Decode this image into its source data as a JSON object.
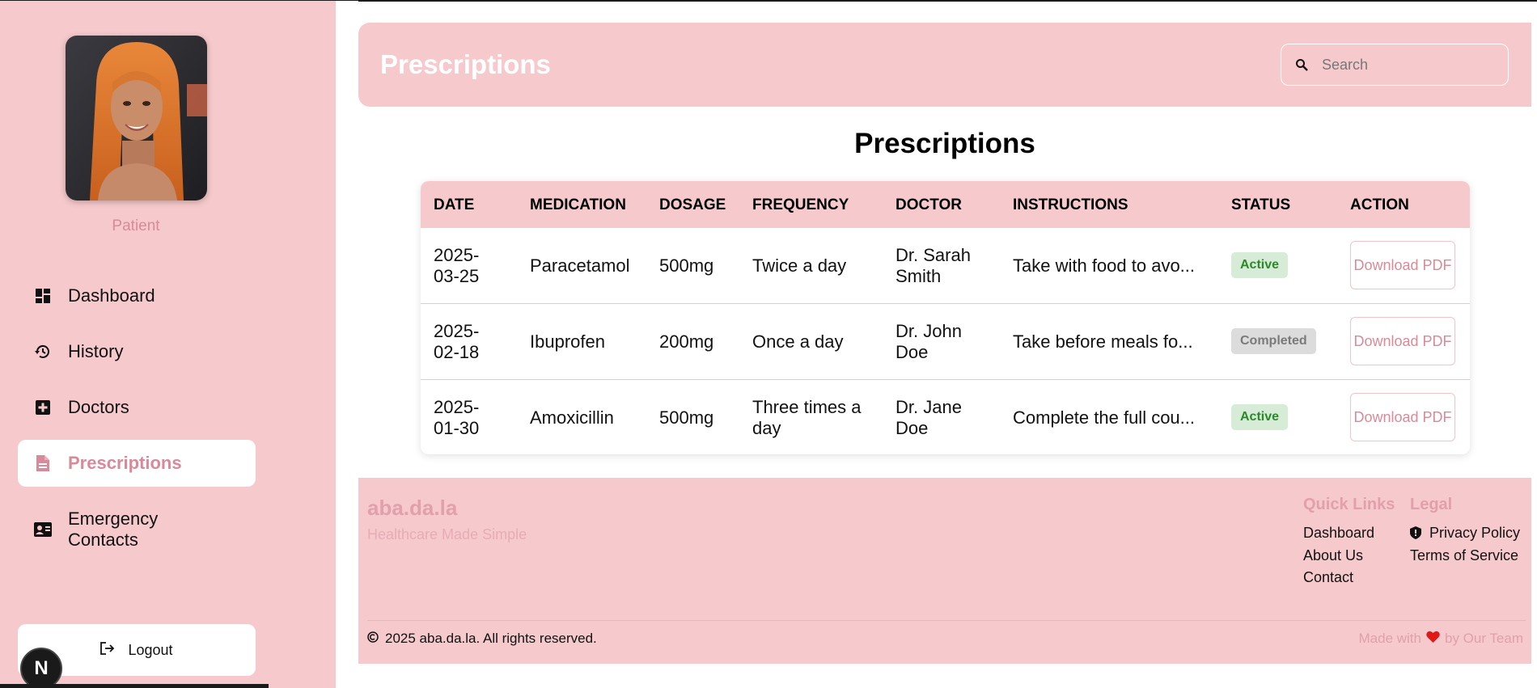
{
  "sidebar": {
    "role": "Patient",
    "items": [
      {
        "label": "Dashboard",
        "icon": "dashboard-icon"
      },
      {
        "label": "History",
        "icon": "history-icon"
      },
      {
        "label": "Doctors",
        "icon": "medical-plus-icon"
      },
      {
        "label": "Prescriptions",
        "icon": "document-icon",
        "active": true
      },
      {
        "label": "Emergency Contacts",
        "icon": "contact-card-icon"
      }
    ],
    "logout_label": "Logout",
    "badge_letter": "N"
  },
  "header": {
    "title": "Prescriptions",
    "search_placeholder": "Search"
  },
  "main": {
    "title": "Prescriptions"
  },
  "table": {
    "columns": [
      "DATE",
      "MEDICATION",
      "DOSAGE",
      "FREQUENCY",
      "DOCTOR",
      "INSTRUCTIONS",
      "STATUS",
      "ACTION"
    ],
    "rows": [
      {
        "date": "2025-03-25",
        "medication": "Paracetamol",
        "dosage": "500mg",
        "frequency": "Twice a day",
        "doctor": "Dr. Sarah Smith",
        "instructions": "Take with food to avo...",
        "status": "Active",
        "action": "Download PDF"
      },
      {
        "date": "2025-02-18",
        "medication": "Ibuprofen",
        "dosage": "200mg",
        "frequency": "Once a day",
        "doctor": "Dr. John Doe",
        "instructions": "Take before meals fo...",
        "status": "Completed",
        "action": "Download PDF"
      },
      {
        "date": "2025-01-30",
        "medication": "Amoxicillin",
        "dosage": "500mg",
        "frequency": "Three times a day",
        "doctor": "Dr. Jane Doe",
        "instructions": "Complete the full cou...",
        "status": "Active",
        "action": "Download PDF"
      }
    ]
  },
  "footer": {
    "brand": "aba.da.la",
    "tagline": "Healthcare Made Simple",
    "quick_links_title": "Quick Links",
    "quick_links": [
      "Dashboard",
      "About Us",
      "Contact"
    ],
    "legal_title": "Legal",
    "legal_links": [
      "Privacy Policy",
      "Terms of Service"
    ],
    "copyright": "2025 aba.da.la. All rights reserved.",
    "made_with_prefix": "Made with",
    "made_with_suffix": "by Our Team"
  },
  "colors": {
    "brand_pink": "#f6cacc",
    "accent_text": "#d98a9a",
    "active_green": "#2a8a2a",
    "heart": "#e01818"
  }
}
